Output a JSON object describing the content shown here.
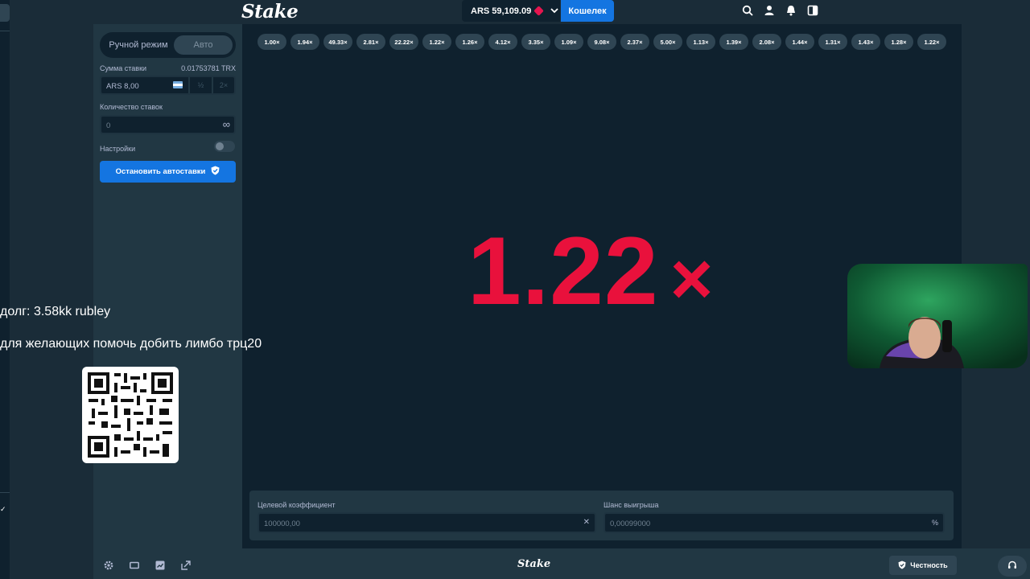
{
  "header": {
    "logo": "Stake",
    "balance": "ARS 59,109.09",
    "wallet_label": "Кошелек",
    "icons": [
      "search-icon",
      "user-icon",
      "bell-icon",
      "sidebar-toggle-icon"
    ]
  },
  "sidebar": {
    "mode_manual": "Ручной режим",
    "mode_auto": "Авто",
    "bet_amount_label": "Сумма ставки",
    "bet_amount_crypto": "0.01753781 TRX",
    "bet_amount_value": "ARS 8,00",
    "half_label": "½",
    "double_label": "2×",
    "bets_count_label": "Количество ставок",
    "bets_count_value": "0",
    "settings_label": "Настройки",
    "stop_autobet_label": "Остановить автоставки"
  },
  "game": {
    "history": [
      "1.00×",
      "1.94×",
      "49.33×",
      "2.81×",
      "22.22×",
      "1.22×",
      "1.26×",
      "4.12×",
      "3.35×",
      "1.09×",
      "9.08×",
      "2.37×",
      "5.00×",
      "1.13×",
      "1.39×",
      "2.08×",
      "1.44×",
      "1.31×",
      "1.43×",
      "1.28×",
      "1.22×"
    ],
    "multiplier": "1.22",
    "multiplier_suffix": "×",
    "target_label": "Целевой коэффициент",
    "target_value": "100000,00",
    "target_clear": "✕",
    "chance_label": "Шанс выигрыша",
    "chance_value": "0,00099000",
    "chance_suffix": "%"
  },
  "footer": {
    "logo": "Stake",
    "fairness_label": "Честность"
  },
  "overlay": {
    "debt_text": "долг: 3.58kk rubley",
    "help_text": "для желающих помочь добить лимбо трц20"
  },
  "colors": {
    "accent_blue": "#1475e1",
    "multiplier_red": "#e9113c",
    "bg_dark": "#0f212e",
    "panel": "#213743"
  }
}
